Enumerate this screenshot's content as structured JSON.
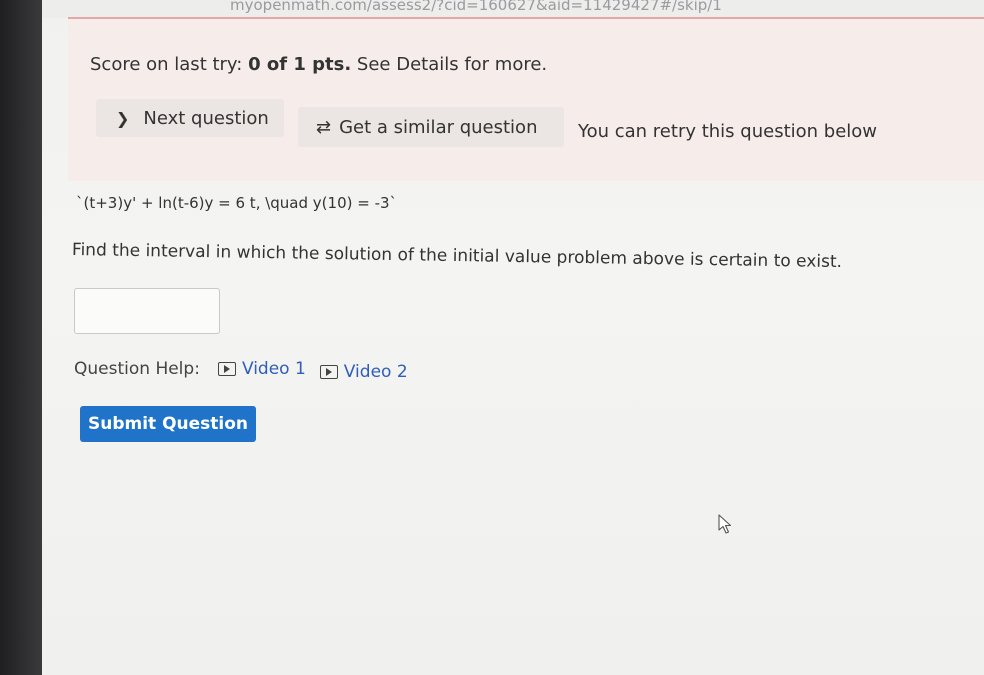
{
  "browser": {
    "url_fragment": "myopenmath.com/assess2/?cid=160627&aid=11429427#/skip/1"
  },
  "score": {
    "prefix": "Score on last try:",
    "value": "0 of 1 pts.",
    "suffix": "See Details for more."
  },
  "actions": {
    "next_label": "Next question",
    "similar_label": "Get a similar question",
    "retry_note": "You can retry this question below"
  },
  "question": {
    "math_text": "`(t+3)y' + ln(t-6)y = 6 t, \\quad y(10) = -3`",
    "prompt": "Find the interval in which the solution of the initial value problem above is certain to exist.",
    "answer_value": "",
    "answer_placeholder": ""
  },
  "help": {
    "label": "Question Help:",
    "videos": [
      "Video 1",
      "Video 2"
    ]
  },
  "submit": {
    "label": "Submit Question"
  },
  "icons": {
    "next": "chevron-right-icon",
    "similar": "retry-arrows-icon",
    "video": "play-icon",
    "cursor": "mouse-pointer-icon"
  },
  "colors": {
    "submit_bg": "#1f74c9",
    "link": "#2f5eb8",
    "score_panel_bg": "#f6ecea",
    "top_rule": "#e4a8a8"
  }
}
